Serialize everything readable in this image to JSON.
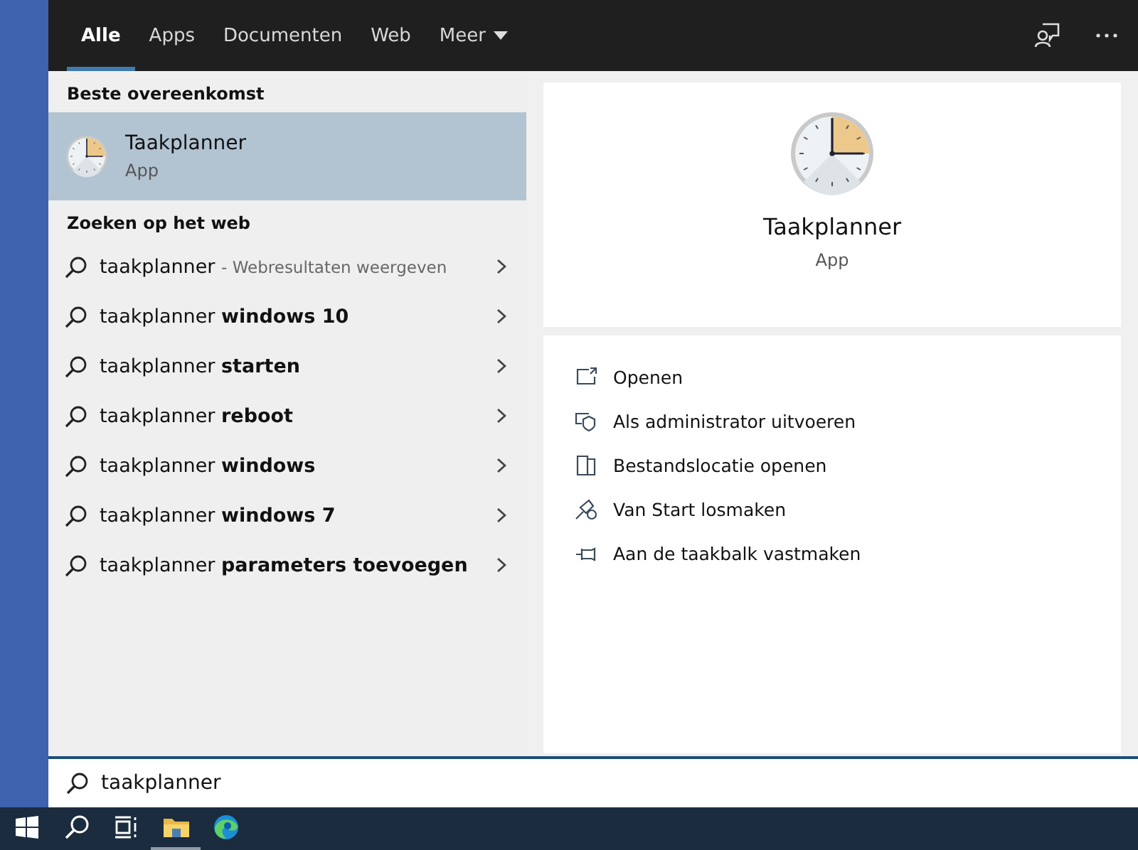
{
  "tabs": [
    {
      "label": "Alle",
      "selected": true
    },
    {
      "label": "Apps",
      "selected": false
    },
    {
      "label": "Documenten",
      "selected": false
    },
    {
      "label": "Web",
      "selected": false
    },
    {
      "label": "Meer",
      "selected": false,
      "dropdown": true
    }
  ],
  "best_match": {
    "heading": "Beste overeenkomst",
    "title": "Taakplanner",
    "subtitle": "App",
    "selected": true
  },
  "web": {
    "heading": "Zoeken op het web",
    "items": [
      {
        "query": "taakplanner",
        "hint": "- Webresultaten weergeven"
      },
      {
        "query": "taakplanner **windows 10**"
      },
      {
        "query": "taakplanner **starten**"
      },
      {
        "query": "taakplanner **reboot**"
      },
      {
        "query": "taakplanner **windows**"
      },
      {
        "query": "taakplanner **windows 7**"
      },
      {
        "query": "taakplanner **parameters toevoegen**"
      }
    ]
  },
  "detail": {
    "title": "Taakplanner",
    "subtitle": "App",
    "actions": [
      {
        "kind": "open",
        "label": "Openen"
      },
      {
        "kind": "admin",
        "label": "Als administrator uitvoeren"
      },
      {
        "kind": "location",
        "label": "Bestandslocatie openen"
      },
      {
        "kind": "unpin",
        "label": "Van Start losmaken"
      },
      {
        "kind": "pin",
        "label": "Aan de taakbalk vastmaken"
      }
    ]
  },
  "search": {
    "value": "taakplanner"
  },
  "taskbar": [
    {
      "kind": "start",
      "running": false
    },
    {
      "kind": "search",
      "running": false
    },
    {
      "kind": "taskview",
      "running": false
    },
    {
      "kind": "explorer",
      "running": true
    },
    {
      "kind": "edge",
      "running": false
    }
  ]
}
